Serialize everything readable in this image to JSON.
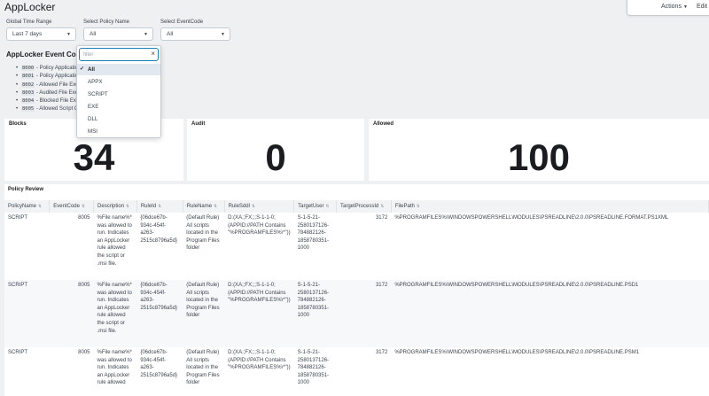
{
  "header": {
    "title": "AppLocker",
    "actions_label": "Actions",
    "edit_label": "Edit"
  },
  "inputs": {
    "time_range": {
      "label": "Global Time Range",
      "value": "Last 7 days"
    },
    "policy_name": {
      "label": "Select Policy Name",
      "value": "All"
    },
    "event_code": {
      "label": "Select EventCode",
      "value": "All"
    }
  },
  "dropdown": {
    "filter_placeholder": "filter",
    "options": [
      "All",
      "APPX",
      "SCRIPT",
      "EXE",
      "DLL",
      "MSI"
    ],
    "selected": "All"
  },
  "event_codes": {
    "title": "AppLocker Event Codes",
    "items": [
      {
        "code": "8000",
        "text": " - Policy Application                            applying the policy."
      },
      {
        "code": "8001",
        "text": " - Policy Application                            plied successfully."
      },
      {
        "code": "8002",
        "text": " - Allowed File Exe"
      },
      {
        "code": "8003",
        "text": " - Audited File Exe                               ged for audit purposes."
      },
      {
        "code": "8004",
        "text": " - Blocked File Exe                                ning."
      },
      {
        "code": "8005",
        "text": " - Allowed Script C                               s allowed to run."
      }
    ]
  },
  "stats": {
    "blocks": {
      "label": "Blocks",
      "value": "34"
    },
    "audit": {
      "label": "Audit",
      "value": "0"
    },
    "allowed": {
      "label": "Allowed",
      "value": "100"
    }
  },
  "policy_review": {
    "title": "Policy Review",
    "columns": [
      "PolicyName",
      "EventCode",
      "Description",
      "RuleId",
      "RuleName",
      "RuleSddl",
      "TargetUser",
      "TargetProcessId",
      "FilePath"
    ],
    "rows": [
      {
        "policy": "SCRIPT",
        "event_code": "8005",
        "description": "%File name%* was allowed to run. Indicates an AppLocker rule allowed the script or .msi file.",
        "rule_id": "{06dce67b-934c-454f-a263-2515c8796a5d}",
        "rule_name": "(Default Rule) All scripts located in the Program Files folder",
        "rule_sddl": "D:(XA;;FX;;;S-1-1-0;(APPID://PATH Contains \"%PROGRAMFILES%\\*\"))",
        "target_user": "S-1-5-21-2580137126-784882126-1858780351-1000",
        "process_id": "3172",
        "file_path": "%PROGRAMFILES%\\WINDOWSPOWERSHELL\\MODULES\\PSREADLINE\\2.0.0\\PSREADLINE.FORMAT.PS1XML"
      },
      {
        "policy": "SCRIPT",
        "event_code": "8005",
        "description": "%File name%* was allowed to run. Indicates an AppLocker rule allowed the script or .msi file.",
        "rule_id": "{06dce67b-934c-454f-a263-2515c8796a5d}",
        "rule_name": "(Default Rule) All scripts located in the Program Files folder",
        "rule_sddl": "D:(XA;;FX;;;S-1-1-0;(APPID://PATH Contains \"%PROGRAMFILES%\\*\"))",
        "target_user": "S-1-5-21-2580137126-784882126-1858780351-1000",
        "process_id": "3172",
        "file_path": "%PROGRAMFILES%\\WINDOWSPOWERSHELL\\MODULES\\PSREADLINE\\2.0.0\\PSREADLINE.PSD1"
      },
      {
        "policy": "SCRIPT",
        "event_code": "8005",
        "description": "%File name%* was allowed to run. Indicates an AppLocker rule allowed",
        "rule_id": "{06dce67b-934c-454f-a263-2515c8796a5d}",
        "rule_name": "(Default Rule) All scripts located in the Program Files folder",
        "rule_sddl": "D:(XA;;FX;;;S-1-1-0;(APPID://PATH Contains \"%PROGRAMFILES%\\*\"))",
        "target_user": "S-1-5-21-2580137126-784882126-1858780351-1000",
        "process_id": "3172",
        "file_path": "%PROGRAMFILES%\\WINDOWSPOWERSHELL\\MODULES\\PSREADLINE\\2.0.0\\PSREADLINE.PSM1"
      }
    ]
  }
}
